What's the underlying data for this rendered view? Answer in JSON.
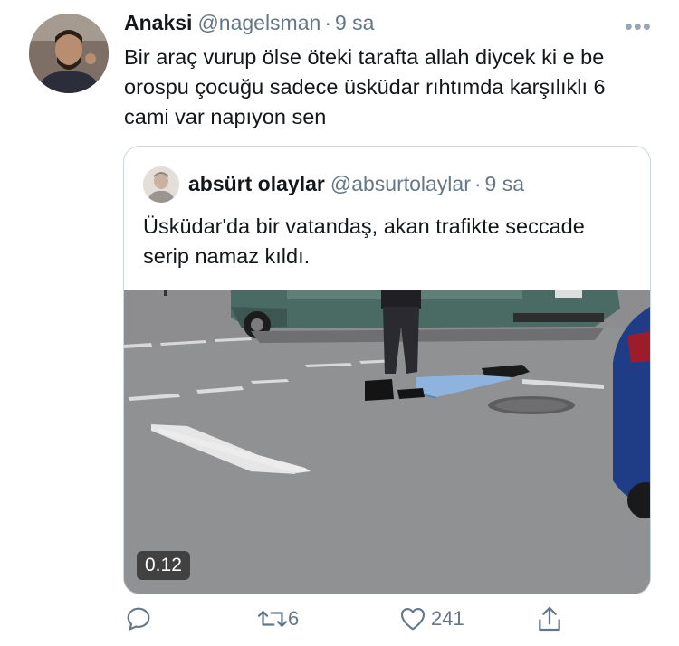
{
  "tweet": {
    "author_name": "Anaksi",
    "handle": "@nagelsman",
    "separator": "·",
    "time": "9 sa",
    "more": "•••",
    "text": "Bir araç vurup ölse öteki tarafta allah diycek ki e be orospu çocuğu sadece üsküdar rıhtımda karşılıklı 6 cami var napıyon sen"
  },
  "quoted": {
    "author_name": "absürt olaylar",
    "handle": "@absurtolaylar",
    "separator": "·",
    "time": "9 sa",
    "text": "Üsküdar'da bir vatandaş, akan trafikte seccade serip namaz kıldı.",
    "video_duration": "0.12"
  },
  "actions": {
    "reply_icon": "reply-icon",
    "retweet_icon": "retweet-icon",
    "retweet_count": "6",
    "like_icon": "heart-icon",
    "like_count": "241",
    "share_icon": "share-icon"
  },
  "colors": {
    "text": "#14171a",
    "secondary": "#657786",
    "border": "#ccd6dd"
  }
}
